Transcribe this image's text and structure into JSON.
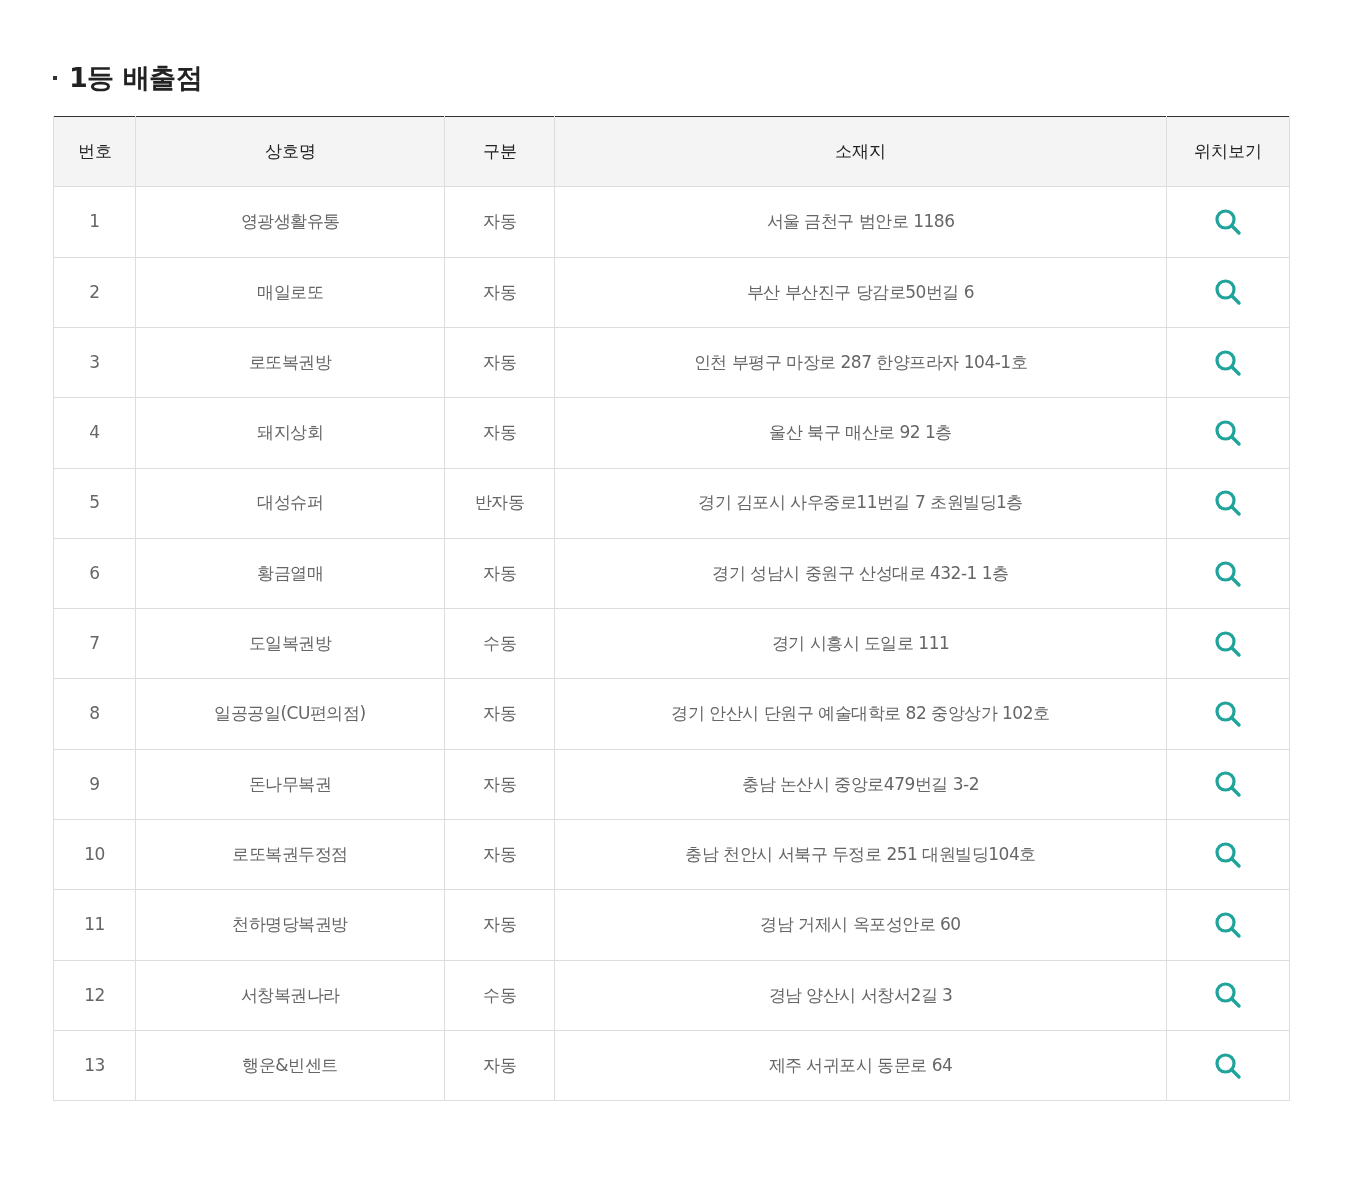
{
  "title": "1등 배출점",
  "table": {
    "columns": [
      "번호",
      "상호명",
      "구분",
      "소재지",
      "위치보기"
    ],
    "rows": [
      {
        "no": "1",
        "name": "영광생활유통",
        "type": "자동",
        "address": "서울 금천구 범안로 1186"
      },
      {
        "no": "2",
        "name": "매일로또",
        "type": "자동",
        "address": "부산 부산진구 당감로50번길 6"
      },
      {
        "no": "3",
        "name": "로또복권방",
        "type": "자동",
        "address": "인천 부평구 마장로 287 한양프라자 104-1호"
      },
      {
        "no": "4",
        "name": "돼지상회",
        "type": "자동",
        "address": "울산 북구 매산로 92 1층"
      },
      {
        "no": "5",
        "name": "대성슈퍼",
        "type": "반자동",
        "address": "경기 김포시 사우중로11번길 7 초원빌딩1층"
      },
      {
        "no": "6",
        "name": "황금열매",
        "type": "자동",
        "address": "경기 성남시 중원구 산성대로 432-1 1층"
      },
      {
        "no": "7",
        "name": "도일복권방",
        "type": "수동",
        "address": "경기 시흥시 도일로 111"
      },
      {
        "no": "8",
        "name": "일공공일(CU편의점)",
        "type": "자동",
        "address": "경기 안산시 단원구 예술대학로 82 중앙상가 102호"
      },
      {
        "no": "9",
        "name": "돈나무복권",
        "type": "자동",
        "address": "충남 논산시 중앙로479번길 3-2"
      },
      {
        "no": "10",
        "name": "로또복권두정점",
        "type": "자동",
        "address": "충남 천안시 서북구 두정로 251 대원빌딩104호"
      },
      {
        "no": "11",
        "name": "천하명당복권방",
        "type": "자동",
        "address": "경남 거제시 옥포성안로 60"
      },
      {
        "no": "12",
        "name": "서창복권나라",
        "type": "수동",
        "address": "경남 양산시 서창서2길 3"
      },
      {
        "no": "13",
        "name": "행운&빈센트",
        "type": "자동",
        "address": "제주 서귀포시 동문로 64"
      }
    ]
  }
}
